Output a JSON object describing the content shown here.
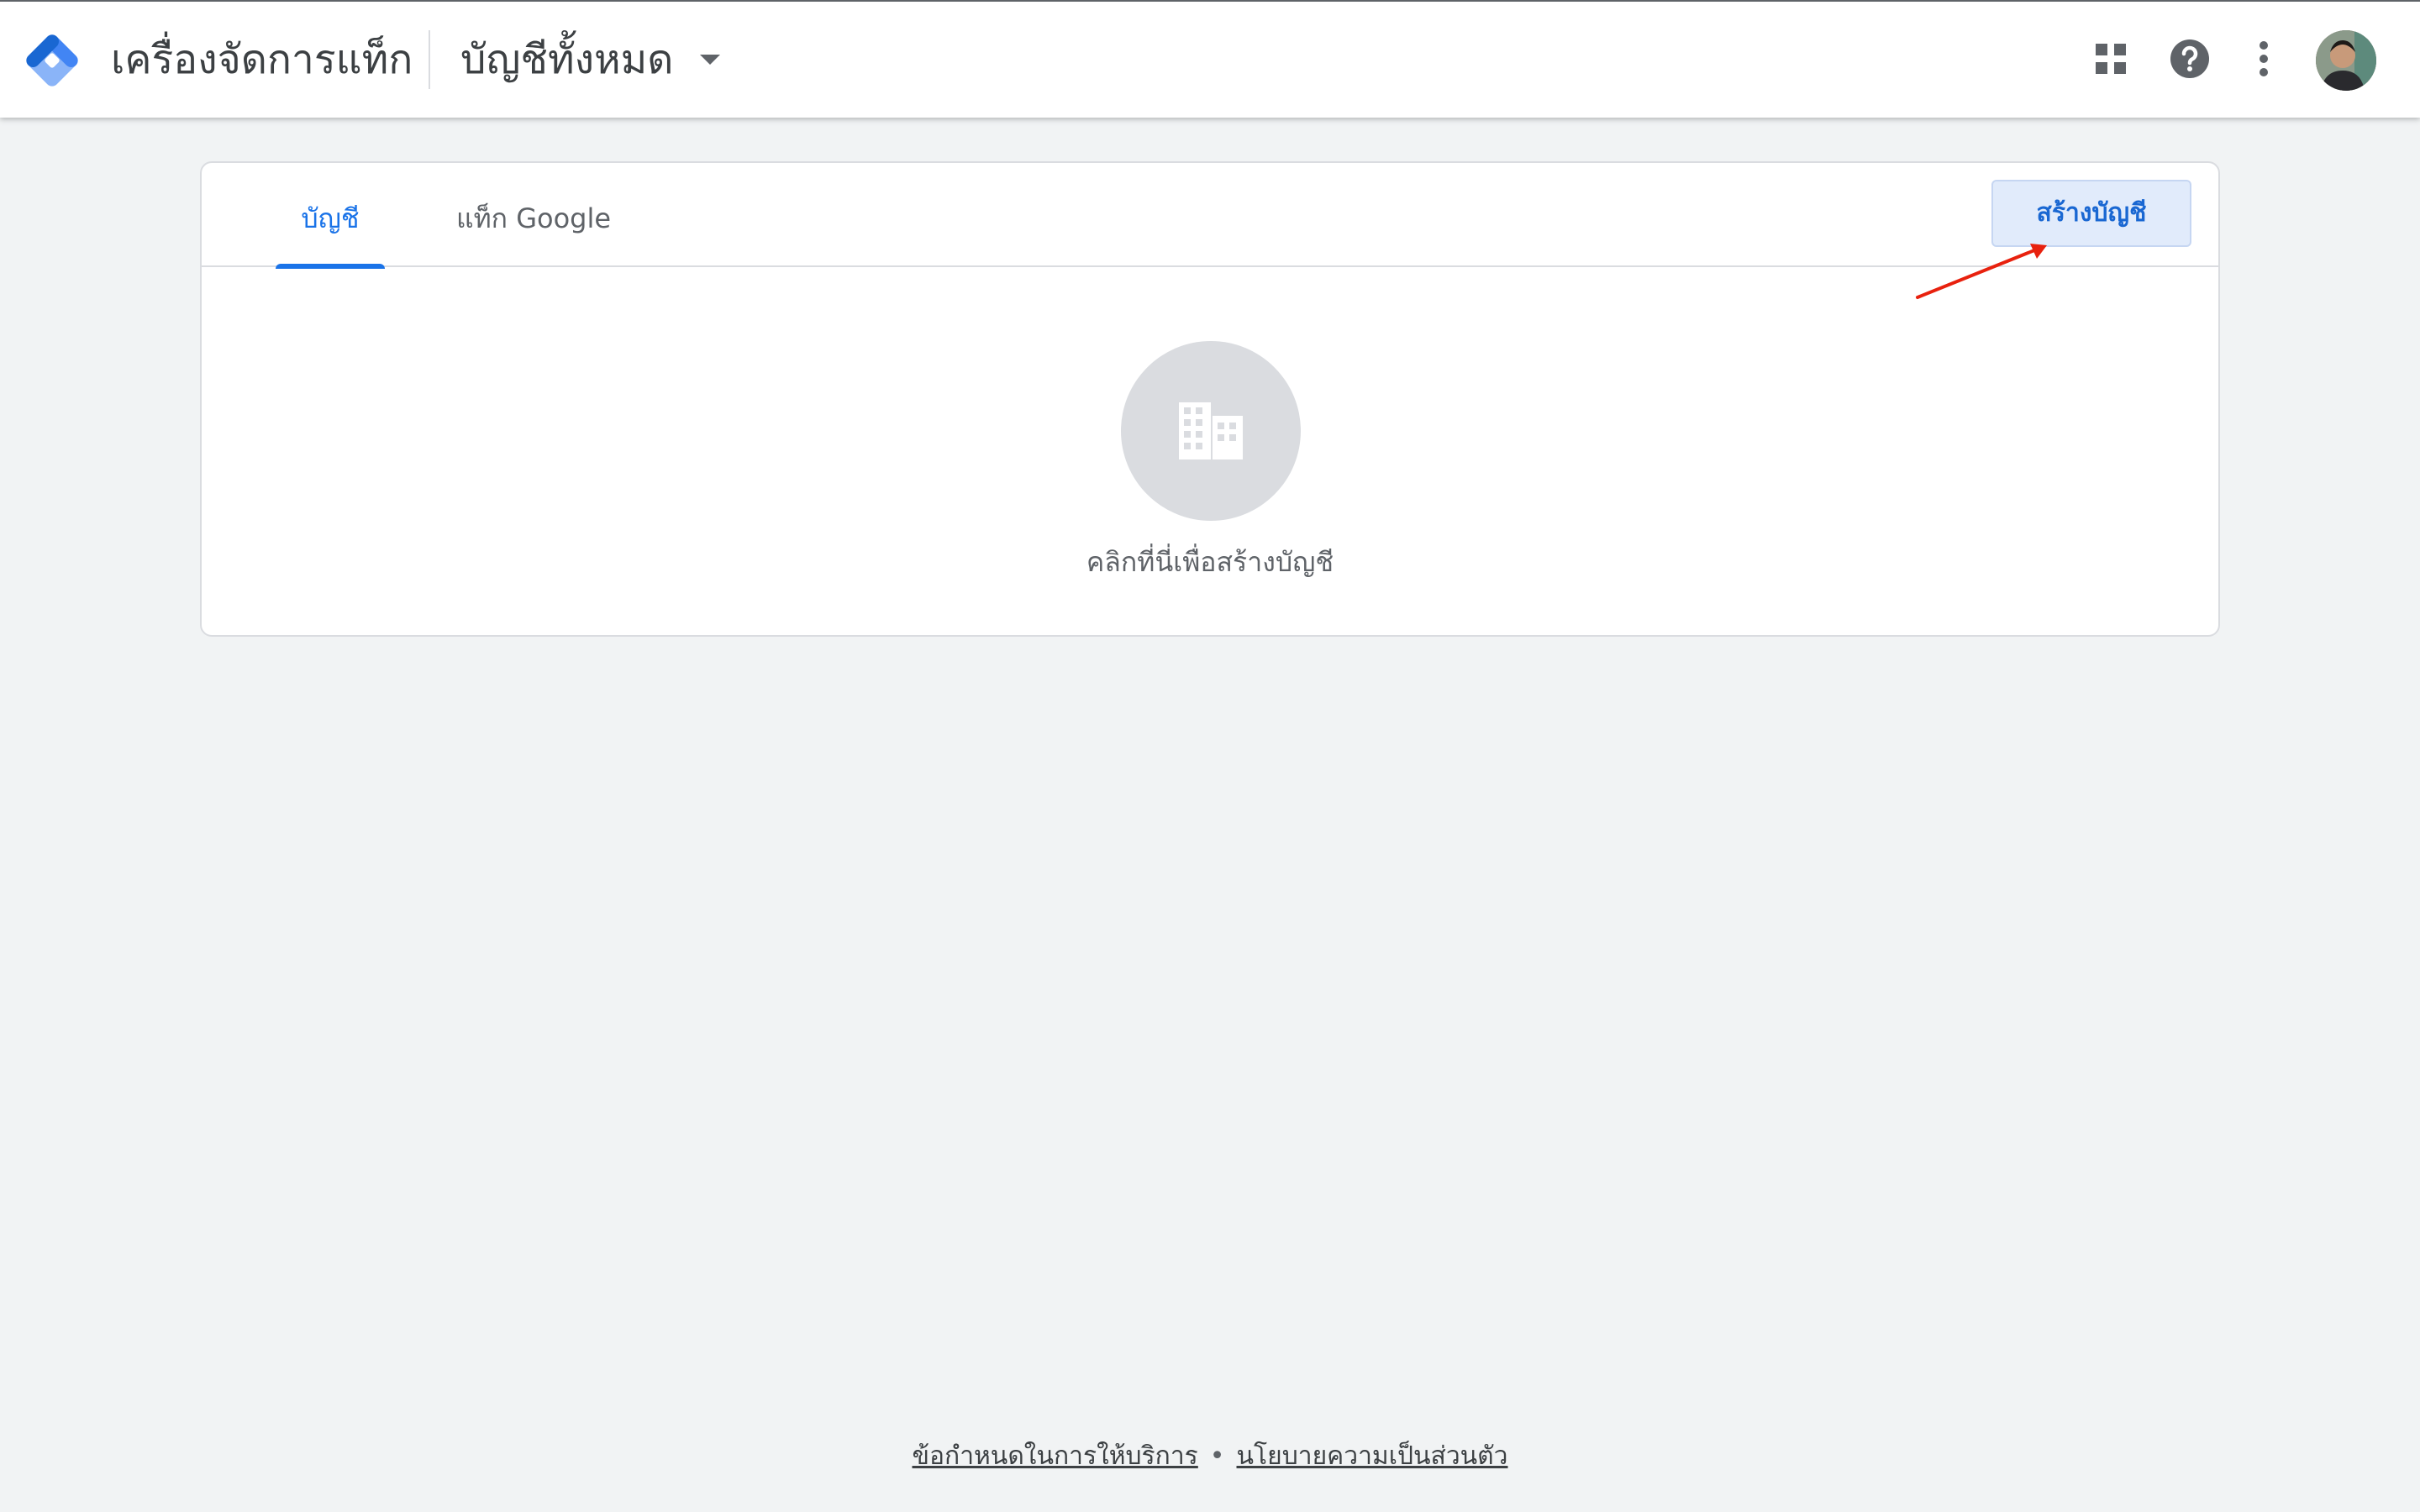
{
  "header": {
    "app_title": "เครื่องจัดการแท็ก",
    "account_selector_label": "บัญชีทั้งหมด",
    "icons": [
      "tag-manager-logo-icon",
      "apps-grid-icon",
      "help-icon",
      "more-vert-icon",
      "avatar"
    ]
  },
  "tabs": [
    {
      "label": "บัญชี",
      "active": true
    },
    {
      "label": "แท็ก Google",
      "active": false
    }
  ],
  "actions": {
    "create_account_label": "สร้างบัญชี"
  },
  "empty_state": {
    "icon": "building-icon",
    "text": "คลิกที่นี่เพื่อสร้างบัญชี"
  },
  "footer": {
    "terms_link": "ข้อกำหนดในการให้บริการ",
    "separator": "•",
    "privacy_link": "นโยบายความเป็นส่วนตัว"
  },
  "colors": {
    "accent": "#1a73e8",
    "background": "#f1f3f4",
    "annotation_arrow": "#e8210e"
  }
}
